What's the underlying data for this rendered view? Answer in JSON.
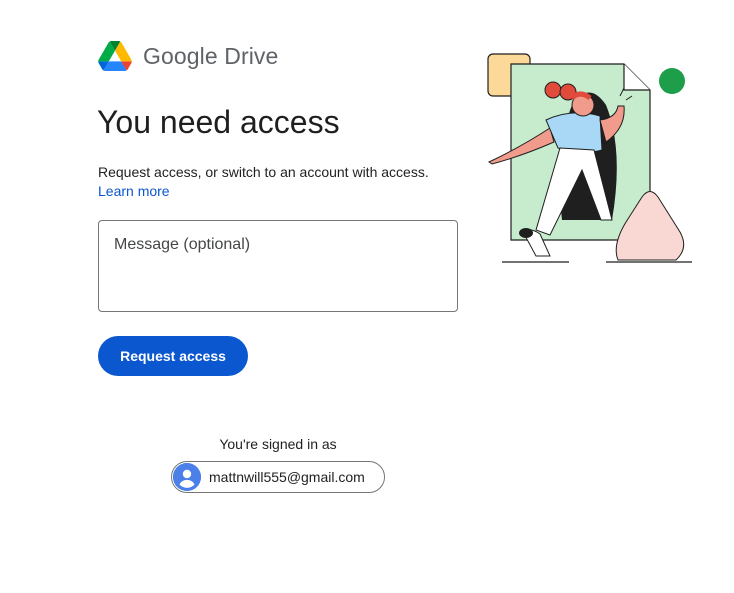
{
  "brand": {
    "name": "Google Drive"
  },
  "page": {
    "heading": "You need access",
    "description": "Request access, or switch to an account with access.",
    "learn_more": "Learn more"
  },
  "form": {
    "message_placeholder": "Message (optional)",
    "message_value": "",
    "submit_label": "Request access"
  },
  "account": {
    "signed_in_label": "You're signed in as",
    "email": "mattnwill555@gmail.com"
  },
  "colors": {
    "accent": "#0b57d0",
    "text": "#1f1f1f",
    "drive_green": "#0f9d58",
    "drive_yellow": "#ffba00",
    "drive_blue": "#4285f4"
  },
  "icons": [
    "google-drive-logo-icon",
    "account-avatar-icon"
  ]
}
